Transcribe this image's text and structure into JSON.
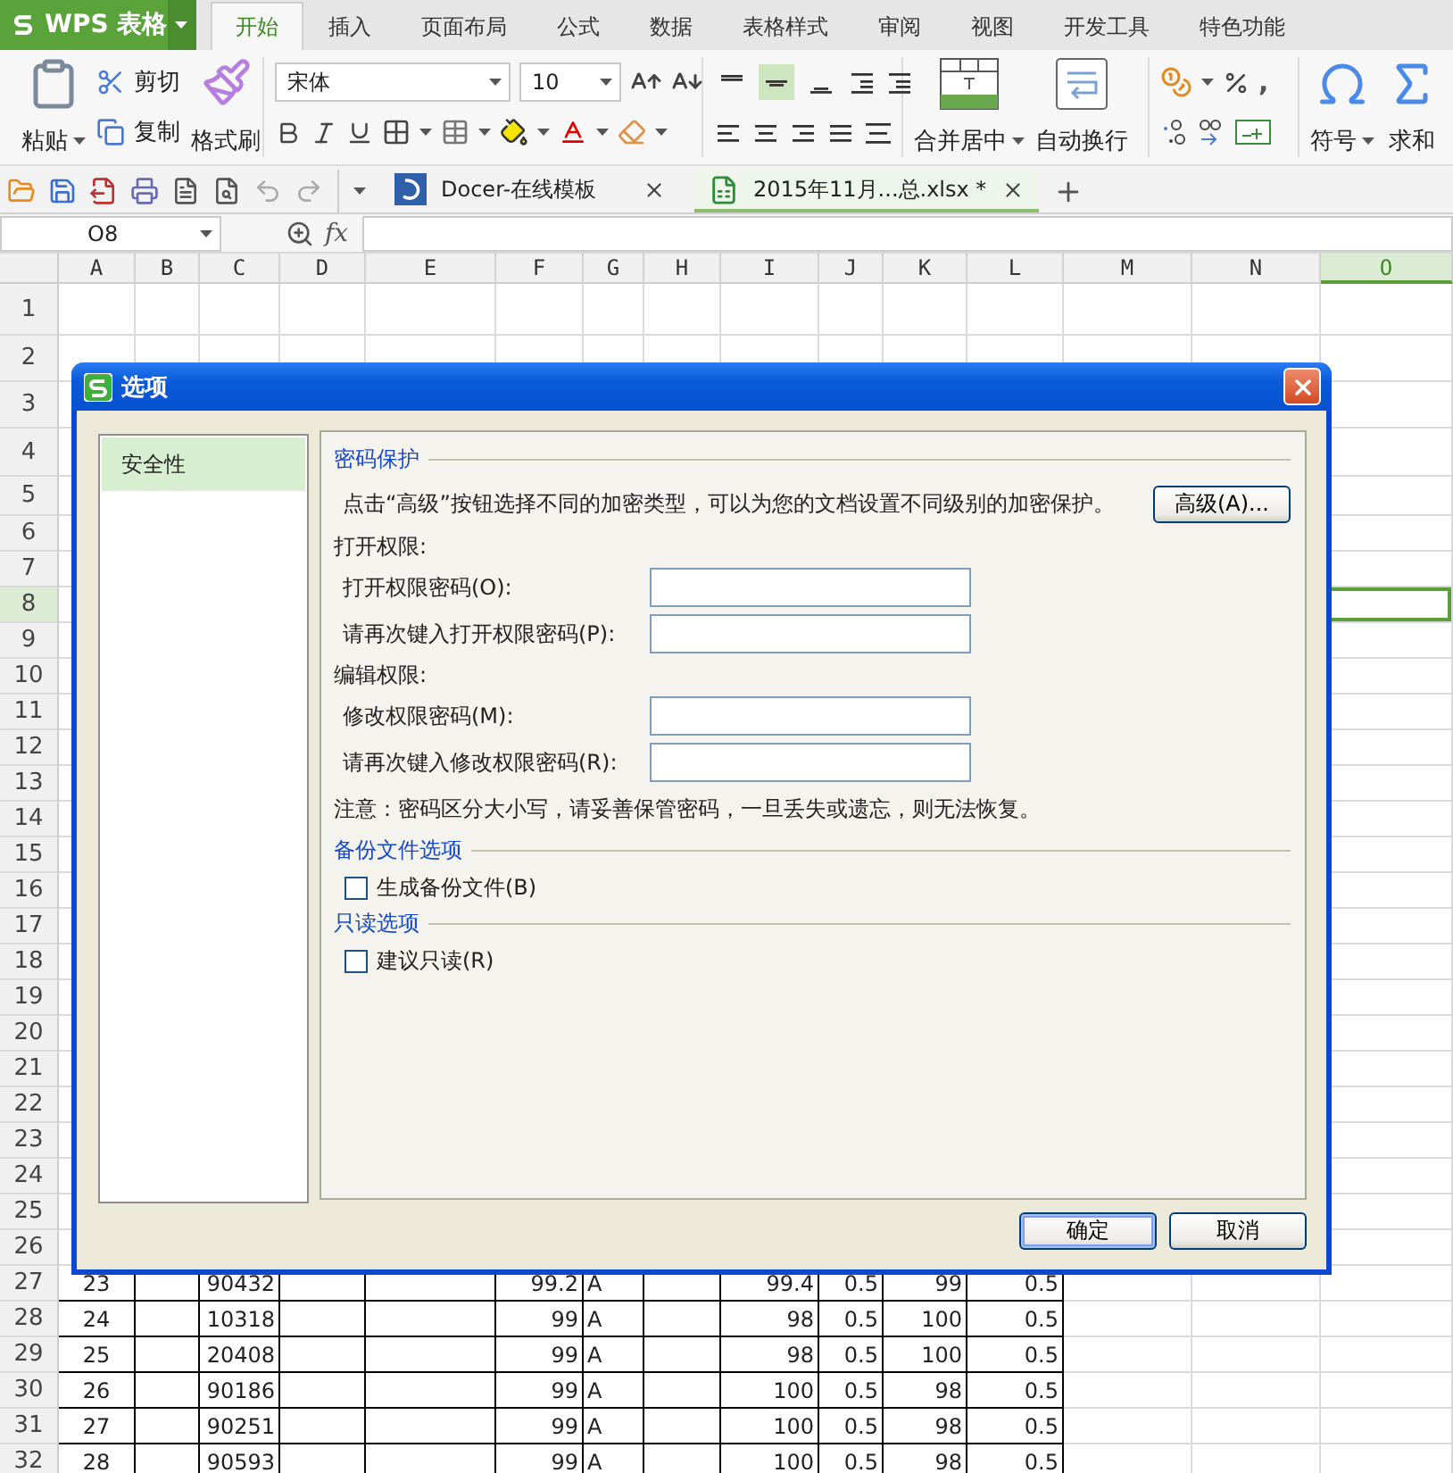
{
  "app_menu": {
    "label": "WPS 表格"
  },
  "ribbon_tabs": [
    {
      "label": "开始",
      "selected": true
    },
    {
      "label": "插入",
      "selected": false
    },
    {
      "label": "页面布局",
      "selected": false
    },
    {
      "label": "公式",
      "selected": false
    },
    {
      "label": "数据",
      "selected": false
    },
    {
      "label": "表格样式",
      "selected": false
    },
    {
      "label": "审阅",
      "selected": false
    },
    {
      "label": "视图",
      "selected": false
    },
    {
      "label": "开发工具",
      "selected": false
    },
    {
      "label": "特色功能",
      "selected": false
    }
  ],
  "toolbar": {
    "paste": "粘贴",
    "cut": "剪切",
    "copy": "复制",
    "format_painter": "格式刷",
    "font": "宋体",
    "size": "10",
    "vertical_align": [
      {
        "selected": false
      },
      {
        "selected": true
      },
      {
        "selected": false
      }
    ],
    "merge": "合并居中",
    "wrap": "自动换行",
    "comma": ",",
    "symbol": "符号",
    "sum": "求和"
  },
  "doc_tabs": [
    {
      "label": "Docer-在线模板",
      "selected": false
    },
    {
      "label": "2015年11月...总.xlsx *",
      "selected": true
    }
  ],
  "formula_bar": {
    "name_box": "O8",
    "fx": "fx"
  },
  "columns": [
    {
      "label": "A",
      "selected": false
    },
    {
      "label": "B",
      "selected": false
    },
    {
      "label": "C",
      "selected": false
    },
    {
      "label": "D",
      "selected": false
    },
    {
      "label": "E",
      "selected": false
    },
    {
      "label": "F",
      "selected": false
    },
    {
      "label": "G",
      "selected": false
    },
    {
      "label": "H",
      "selected": false
    },
    {
      "label": "I",
      "selected": false
    },
    {
      "label": "J",
      "selected": false
    },
    {
      "label": "K",
      "selected": false
    },
    {
      "label": "L",
      "selected": false
    },
    {
      "label": "M",
      "selected": false
    },
    {
      "label": "N",
      "selected": false
    },
    {
      "label": "O",
      "selected": true
    }
  ],
  "rows": [
    {
      "number": "1",
      "selected": false
    },
    {
      "number": "2",
      "selected": false
    },
    {
      "number": "3",
      "selected": false
    },
    {
      "number": "4",
      "selected": false
    },
    {
      "number": "5",
      "selected": false
    },
    {
      "number": "6",
      "selected": false
    },
    {
      "number": "7",
      "selected": false
    },
    {
      "number": "8",
      "selected": true
    },
    {
      "number": "9",
      "selected": false
    },
    {
      "number": "10",
      "selected": false
    },
    {
      "number": "11",
      "selected": false
    },
    {
      "number": "12",
      "selected": false
    },
    {
      "number": "13",
      "selected": false
    },
    {
      "number": "14",
      "selected": false
    },
    {
      "number": "15",
      "selected": false
    },
    {
      "number": "16",
      "selected": false
    },
    {
      "number": "17",
      "selected": false
    },
    {
      "number": "18",
      "selected": false
    },
    {
      "number": "19",
      "selected": false
    },
    {
      "number": "20",
      "selected": false
    },
    {
      "number": "21",
      "selected": false
    },
    {
      "number": "22",
      "selected": false
    },
    {
      "number": "23",
      "selected": false
    },
    {
      "number": "24",
      "selected": false
    },
    {
      "number": "25",
      "selected": false
    },
    {
      "number": "26",
      "selected": false
    },
    {
      "number": "27",
      "selected": false,
      "cells": [
        "23",
        null,
        "90432",
        null,
        null,
        "99.2",
        "A",
        null,
        "99.4",
        "0.5",
        "99",
        "0.5"
      ]
    },
    {
      "number": "28",
      "selected": false,
      "cells": [
        "24",
        null,
        "10318",
        null,
        null,
        "99",
        "A",
        null,
        "98",
        "0.5",
        "100",
        "0.5"
      ]
    },
    {
      "number": "29",
      "selected": false,
      "cells": [
        "25",
        null,
        "20408",
        null,
        null,
        "99",
        "A",
        null,
        "98",
        "0.5",
        "100",
        "0.5"
      ]
    },
    {
      "number": "30",
      "selected": false,
      "cells": [
        "26",
        null,
        "90186",
        null,
        null,
        "99",
        "A",
        null,
        "100",
        "0.5",
        "98",
        "0.5"
      ]
    },
    {
      "number": "31",
      "selected": false,
      "cells": [
        "27",
        null,
        "90251",
        null,
        null,
        "99",
        "A",
        null,
        "100",
        "0.5",
        "98",
        "0.5"
      ]
    },
    {
      "number": "32",
      "selected": false,
      "cells": [
        "28",
        null,
        "90593",
        null,
        null,
        "99",
        "A",
        null,
        "100",
        "0.5",
        "98",
        "0.5"
      ]
    }
  ],
  "dialog": {
    "title": "选项",
    "nav": [
      {
        "label": "安全性",
        "selected": true
      }
    ],
    "sections": [
      {
        "heading": "密码保护",
        "items": [
          {
            "kind": "note_button",
            "text": "点击“高级”按钮选择不同的加密类型，可以为您的文档设置不同级别的加密保护。",
            "button": "高级(A)..."
          },
          {
            "kind": "subheading",
            "text": "打开权限:"
          },
          {
            "kind": "field",
            "label": "打开权限密码(O):"
          },
          {
            "kind": "field",
            "label": "请再次键入打开权限密码(P):"
          },
          {
            "kind": "subheading",
            "text": "编辑权限:"
          },
          {
            "kind": "field",
            "label": "修改权限密码(M):"
          },
          {
            "kind": "field",
            "label": "请再次键入修改权限密码(R):"
          },
          {
            "kind": "note",
            "text": "注意：密码区分大小写，请妥善保管密码，一旦丢失或遗忘，则无法恢复。"
          }
        ]
      },
      {
        "heading": "备份文件选项",
        "items": [
          {
            "kind": "checkbox",
            "label": "生成备份文件(B)",
            "checked": false
          }
        ]
      },
      {
        "heading": "只读选项",
        "items": [
          {
            "kind": "checkbox",
            "label": "建议只读(R)",
            "checked": false
          }
        ]
      }
    ],
    "buttons": [
      "确定",
      "取消"
    ]
  }
}
